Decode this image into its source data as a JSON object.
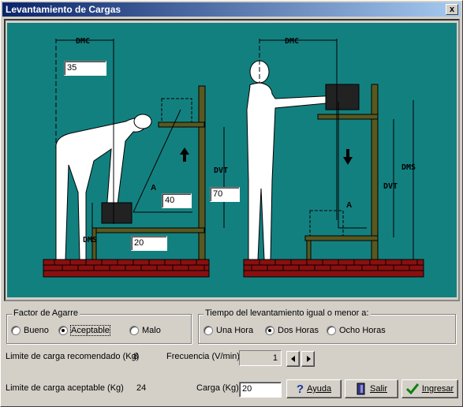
{
  "window": {
    "title": "Levantamiento de Cargas",
    "close_glyph": "x"
  },
  "scene": {
    "left": {
      "dmc_label": "DMC",
      "dvt_label": "DVT",
      "dms_label": "DMS",
      "angle_label": "A",
      "dmc_value": "35",
      "dvt_value": "70",
      "angle_value": "40",
      "dms_value": "20"
    },
    "right": {
      "dmc_label": "DMC",
      "dvt_label": "DVT",
      "dms_label": "DMS",
      "angle_label": "A"
    }
  },
  "agarre": {
    "legend": "Factor de Agarre",
    "options": [
      "Bueno",
      "Aceptable",
      "Malo"
    ],
    "selected": "Aceptable"
  },
  "tiempo": {
    "legend": "Tiempo del levantamiento igual o menor a:",
    "options": [
      "Una Hora",
      "Dos Horas",
      "Ocho Horas"
    ],
    "selected": "Dos Horas"
  },
  "results": {
    "recomendado_label": "Limite de carga recomendado (Kg)",
    "recomendado_value": "8",
    "aceptable_label": "Limite de carga aceptable (Kg)",
    "aceptable_value": "24"
  },
  "frecuencia": {
    "label": "Frecuencia (V/min)",
    "value": "1"
  },
  "carga": {
    "label": "Carga (Kg)",
    "value": "20"
  },
  "buttons": {
    "ayuda": "Ayuda",
    "salir": "Salir",
    "ingresar": "Ingresar"
  },
  "colors": {
    "teal": "#138080",
    "wood": "#585820",
    "brick": "#8a1010",
    "titlebar": "#0a246a"
  }
}
